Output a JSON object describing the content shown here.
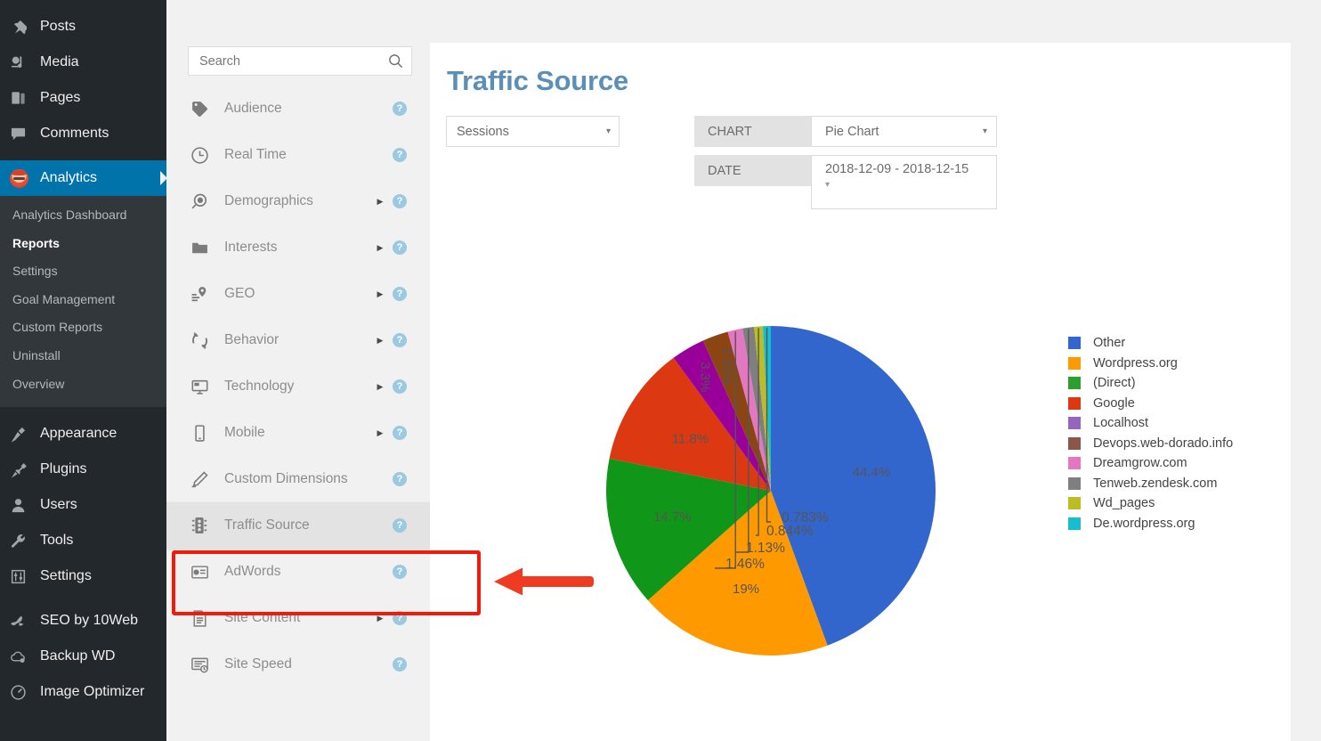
{
  "wp_sidebar": {
    "groups": [
      {
        "items": [
          {
            "label": "Posts",
            "icon": "pin-icon",
            "name": "posts"
          },
          {
            "label": "Media",
            "icon": "media-icon",
            "name": "media"
          },
          {
            "label": "Pages",
            "icon": "pages-icon",
            "name": "pages"
          },
          {
            "label": "Comments",
            "icon": "comment-icon",
            "name": "comments"
          }
        ]
      },
      {
        "items": [
          {
            "label": "Analytics",
            "icon": "analytics-avatar-icon",
            "name": "analytics",
            "current": true
          }
        ],
        "submenu": [
          {
            "label": "Analytics Dashboard",
            "name": "analytics-dashboard",
            "active": false
          },
          {
            "label": "Reports",
            "name": "reports",
            "active": true
          },
          {
            "label": "Settings",
            "name": "settings",
            "active": false
          },
          {
            "label": "Goal Management",
            "name": "goal-management",
            "active": false
          },
          {
            "label": "Custom Reports",
            "name": "custom-reports",
            "active": false
          },
          {
            "label": "Uninstall",
            "name": "uninstall",
            "active": false
          },
          {
            "label": "Overview",
            "name": "overview",
            "active": false
          }
        ]
      },
      {
        "items": [
          {
            "label": "Appearance",
            "icon": "brush-icon",
            "name": "appearance"
          },
          {
            "label": "Plugins",
            "icon": "plug-icon",
            "name": "plugins"
          },
          {
            "label": "Users",
            "icon": "user-icon",
            "name": "users"
          },
          {
            "label": "Tools",
            "icon": "wrench-icon",
            "name": "tools"
          },
          {
            "label": "Settings",
            "icon": "sliders-icon",
            "name": "settings"
          }
        ]
      },
      {
        "items": [
          {
            "label": "SEO by 10Web",
            "icon": "seo-icon",
            "name": "seo-by-10web"
          },
          {
            "label": "Backup WD",
            "icon": "cloud-icon",
            "name": "backup-wd"
          },
          {
            "label": "Image Optimizer",
            "icon": "gauge-icon",
            "name": "image-optimizer"
          }
        ]
      }
    ]
  },
  "reports_nav": {
    "search": {
      "placeholder": "Search",
      "value": "",
      "icon": "search-icon"
    },
    "help_glyph": "?",
    "caret_glyph": "▶",
    "items": [
      {
        "label": "Audience",
        "icon": "tag-icon",
        "name": "audience",
        "caret": false,
        "help": true,
        "selected": false
      },
      {
        "label": "Real Time",
        "icon": "clock-icon",
        "name": "real-time",
        "caret": false,
        "help": true,
        "selected": false
      },
      {
        "label": "Demographics",
        "icon": "demographics-icon",
        "name": "demographics",
        "caret": true,
        "help": true,
        "selected": false
      },
      {
        "label": "Interests",
        "icon": "folder-icon",
        "name": "interests",
        "caret": true,
        "help": true,
        "selected": false
      },
      {
        "label": "GEO",
        "icon": "geo-pin-icon",
        "name": "geo",
        "caret": true,
        "help": true,
        "selected": false
      },
      {
        "label": "Behavior",
        "icon": "refresh-icon",
        "name": "behavior",
        "caret": true,
        "help": true,
        "selected": false
      },
      {
        "label": "Technology",
        "icon": "monitor-icon",
        "name": "technology",
        "caret": true,
        "help": true,
        "selected": false
      },
      {
        "label": "Mobile",
        "icon": "phone-icon",
        "name": "mobile",
        "caret": true,
        "help": true,
        "selected": false
      },
      {
        "label": "Custom Dimensions",
        "icon": "pencil-icon",
        "name": "custom-dimensions",
        "caret": false,
        "help": true,
        "selected": false
      },
      {
        "label": "Traffic Source",
        "icon": "traffic-light-icon",
        "name": "traffic-source",
        "caret": false,
        "help": true,
        "selected": true
      },
      {
        "label": "AdWords",
        "icon": "adwords-icon",
        "name": "adwords",
        "caret": false,
        "help": true,
        "selected": false
      },
      {
        "label": "Site Content",
        "icon": "document-icon",
        "name": "site-content",
        "caret": true,
        "help": true,
        "selected": false
      },
      {
        "label": "Site Speed",
        "icon": "speed-icon",
        "name": "site-speed",
        "caret": false,
        "help": true,
        "selected": false
      }
    ]
  },
  "annotation": {
    "highlight_color": "#f11b0b",
    "arrow_color": "#ee3b22",
    "target": "Traffic Source"
  },
  "main": {
    "title": "Traffic Source",
    "title_color": "#5b8fb8",
    "metric_select": {
      "value": "Sessions",
      "caret": "▾"
    },
    "chart_control": {
      "label": "CHART",
      "value": "Pie Chart",
      "caret": "▾"
    },
    "date_control": {
      "label": "DATE",
      "value": "2018-12-09 - 2018-12-15",
      "caret": "▾"
    }
  },
  "chart_data": {
    "type": "pie",
    "title": "Traffic Source",
    "metric": "Sessions",
    "date_range": "2018-12-09 - 2018-12-15",
    "legend_position": "right",
    "categories": [
      "Other",
      "Wordpress.org",
      "(Direct)",
      "Google",
      "Localhost",
      "Devops.web-dorado.info",
      "Dreamgrow.com",
      "Tenweb.zendesk.com",
      "Wd_pages",
      "De.wordpress.org"
    ],
    "values": [
      44.4,
      19,
      14.7,
      11.8,
      3.3,
      2.55,
      1.46,
      1.13,
      0.844,
      0.783
    ],
    "value_labels": [
      "44.4%",
      "19%",
      "14.7%",
      "11.8%",
      "3.3%",
      "2.55%",
      "1.46%",
      "1.13%",
      "0.844%",
      "0.783%"
    ],
    "colors": [
      "#3366cc",
      "#ff9900",
      "#109618",
      "#dc3912",
      "#990099",
      "#8b4513",
      "#e377c2",
      "#7f7f7f",
      "#bcbd22",
      "#17becf"
    ],
    "swatch_colors": [
      "#3366cc",
      "#ff9900",
      "#2ca02c",
      "#dc3912",
      "#9467bd",
      "#8c564b",
      "#e377c2",
      "#7f7f7f",
      "#bcbd22",
      "#17becf"
    ],
    "callouts": [
      {
        "label": "0.783%",
        "series": "De.wordpress.org"
      },
      {
        "label": "0.844%",
        "series": "Wd_pages"
      },
      {
        "label": "1.13%",
        "series": "Tenweb.zendesk.com"
      },
      {
        "label": "1.46%",
        "series": "Dreamgrow.com"
      }
    ],
    "inline_labels": [
      {
        "label": "44.4%",
        "series": "Other"
      },
      {
        "label": "19%",
        "series": "Wordpress.org"
      },
      {
        "label": "14.7%",
        "series": "(Direct)"
      },
      {
        "label": "11.8%",
        "series": "Google"
      },
      {
        "label": "3.3%",
        "series": "Localhost"
      },
      {
        "label": "2.55%",
        "series": "Devops.web-dorado.info"
      }
    ]
  }
}
